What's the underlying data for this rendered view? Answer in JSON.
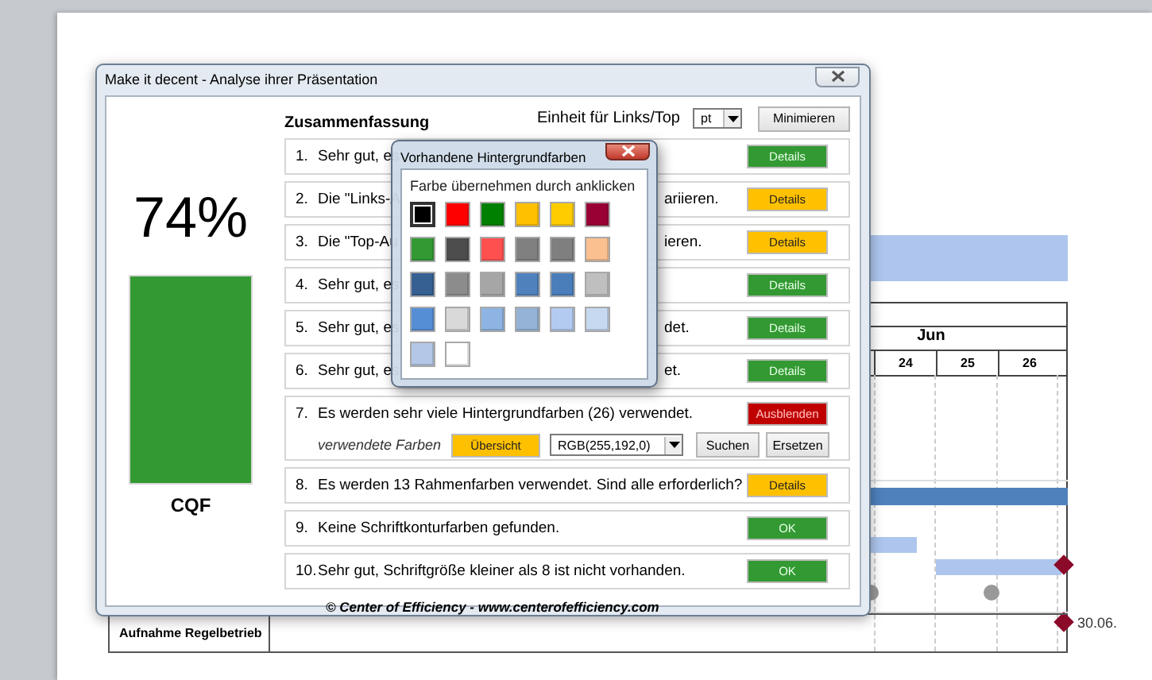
{
  "slide": {
    "month": "Jun",
    "days": [
      "24",
      "25",
      "26"
    ],
    "task": "Aufnahme Regelbetrieb",
    "milestone_date": "30.06."
  },
  "dialog": {
    "title": "Make it decent - Analyse ihrer Präsentation",
    "percent": "74%",
    "score_label": "CQF",
    "heading": "Zusammenfassung",
    "unit_label": "Einheit für Links/Top",
    "unit_value": "pt",
    "minimize": "Minimieren",
    "rows": [
      {
        "number": "1.",
        "text": "Sehr gut, es",
        "button": "Details",
        "color": "#339933"
      },
      {
        "number": "2.",
        "text": "Die \"Links-A",
        "tail": "ariieren.",
        "button": "Details",
        "color": "#ffc000"
      },
      {
        "number": "3.",
        "text": "Die \"Top-Au",
        "tail": "ieren.",
        "button": "Details",
        "color": "#ffc000"
      },
      {
        "number": "4.",
        "text": "Sehr gut, es",
        "button": "Details",
        "color": "#339933"
      },
      {
        "number": "5.",
        "text": "Sehr gut, es",
        "tail": "det.",
        "button": "Details",
        "color": "#339933"
      },
      {
        "number": "6.",
        "text": "Sehr gut, es",
        "tail": "et.",
        "button": "Details",
        "color": "#339933"
      },
      {
        "number": "7.",
        "text": "Es werden sehr viele Hintergrundfarben (26) verwendet.",
        "button": "Ausblenden",
        "color": "#c00000",
        "extra": {
          "label": "verwendete Farben",
          "overview": "Übersicht",
          "color_value": "RGB(255,192,0)",
          "search": "Suchen",
          "replace": "Ersetzen"
        }
      },
      {
        "number": "8.",
        "text": "Es werden 13 Rahmenfarben verwendet. Sind alle erforderlich?",
        "button": "Details",
        "color": "#ffc000"
      },
      {
        "number": "9.",
        "text": "Keine Schriftkonturfarben gefunden.",
        "button": "OK",
        "color": "#339933"
      },
      {
        "number": "10.",
        "text": "Sehr gut, Schriftgröße kleiner als 8 ist nicht vorhanden.",
        "button": "OK",
        "color": "#339933"
      }
    ],
    "footer": "© Center of Efficiency - www.centerofefficiency.com"
  },
  "popup": {
    "title": "Vorhandene Hintergrundfarben",
    "hint": "Farbe übernehmen durch anklicken",
    "colors": [
      {
        "color": "#000000",
        "selected": true
      },
      {
        "color": "#ff0000",
        "selected": false
      },
      {
        "color": "#008000",
        "selected": false
      },
      {
        "color": "#ffc000",
        "selected": false
      },
      {
        "color": "#ffcc00",
        "selected": false
      },
      {
        "color": "#990033",
        "selected": false
      },
      {
        "color": "#339933",
        "selected": false
      },
      {
        "color": "#4d4d4d",
        "selected": false
      },
      {
        "color": "#ff5050",
        "selected": false
      },
      {
        "color": "#808080",
        "selected": false
      },
      {
        "color": "#7f7f7f",
        "selected": false
      },
      {
        "color": "#fac090",
        "selected": false
      },
      {
        "color": "#366092",
        "selected": false
      },
      {
        "color": "#8c8c8c",
        "selected": false
      },
      {
        "color": "#a6a6a6",
        "selected": false
      },
      {
        "color": "#4f81bd",
        "selected": false
      },
      {
        "color": "#4a7ebb",
        "selected": false
      },
      {
        "color": "#bfbfbf",
        "selected": false
      },
      {
        "color": "#558ed5",
        "selected": false
      },
      {
        "color": "#d9d9d9",
        "selected": false
      },
      {
        "color": "#8eb4e3",
        "selected": false
      },
      {
        "color": "#95b3d7",
        "selected": false
      },
      {
        "color": "#b3cbf0",
        "selected": false
      },
      {
        "color": "#c6d9f1",
        "selected": false
      },
      {
        "color": "#b4c7e7",
        "selected": false
      },
      {
        "color": "#ffffff",
        "selected": false
      }
    ]
  }
}
